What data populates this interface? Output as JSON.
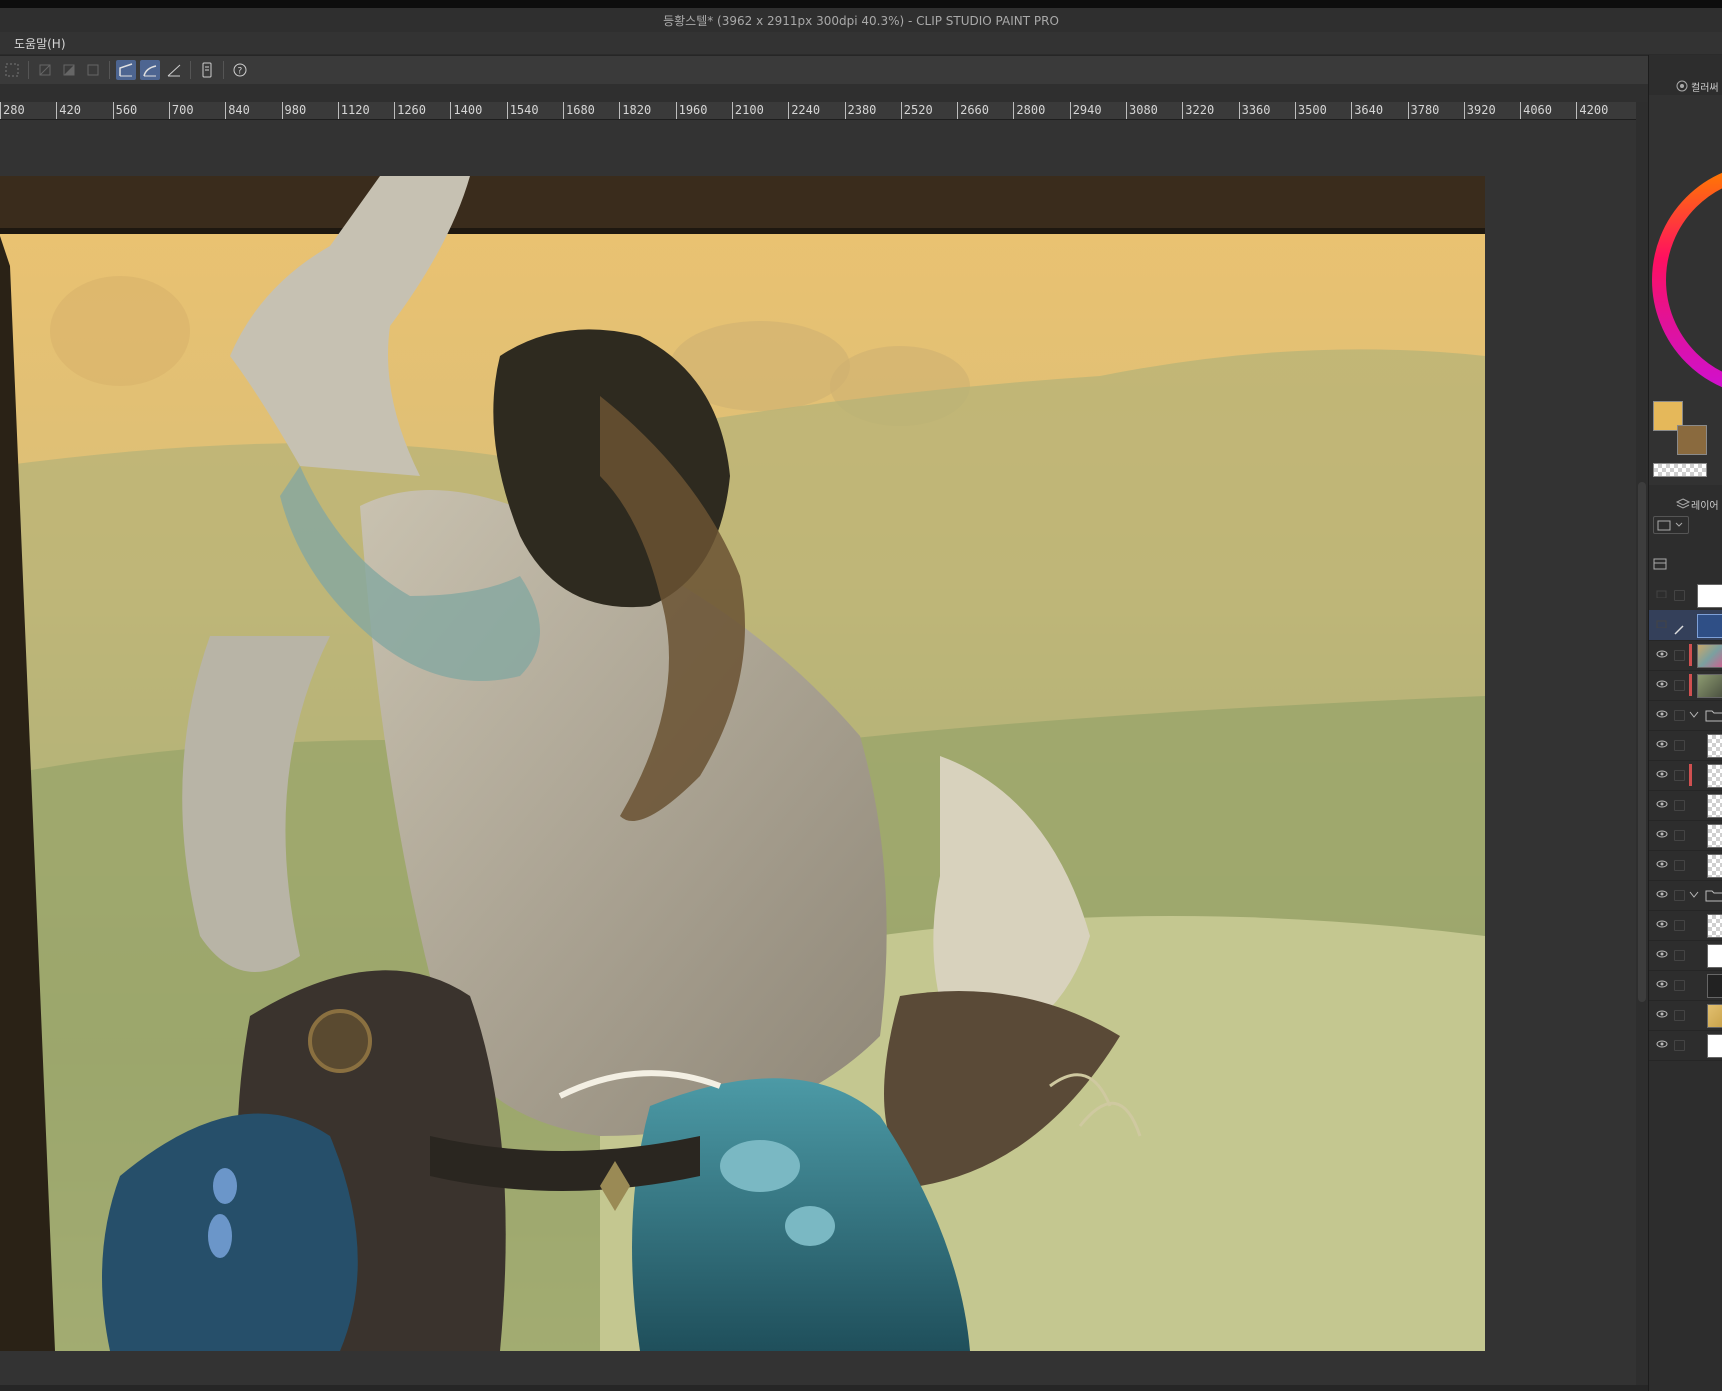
{
  "window": {
    "title": "등황스텔* (3962 x 2911px 300dpi 40.3%)  - CLIP STUDIO PAINT PRO"
  },
  "menu": {
    "items": [
      {
        "label": "도움말(H)"
      }
    ]
  },
  "toolbar": {
    "icons": [
      "select-rect-icon",
      "crop-icon",
      "fill-icon",
      "gradient-icon",
      "frame-icon",
      "pen-icon",
      "brush-curve-icon",
      "ruler-angle-icon",
      "tablet-icon",
      "help-icon"
    ],
    "active": [
      "pen-icon",
      "brush-curve-icon"
    ]
  },
  "ruler": {
    "labels": [
      "280",
      "420",
      "560",
      "700",
      "840",
      "980",
      "1120",
      "1260",
      "1400",
      "1540",
      "1680",
      "1820",
      "1960",
      "2100",
      "2240",
      "2380",
      "2520",
      "2660",
      "2800",
      "2940",
      "3080",
      "3220",
      "3360",
      "3500",
      "3640",
      "3780",
      "3920",
      "4060",
      "4200"
    ]
  },
  "panels": {
    "color": {
      "title": "컬러써",
      "main_color": "#e5b85a",
      "sub_color": "#8a6a3e"
    },
    "layer": {
      "title": "레이어",
      "rows": [
        {
          "visible": false,
          "thumb": "white"
        },
        {
          "visible": false,
          "thumb": "blue",
          "editing": true
        },
        {
          "visible": true,
          "thumb": "art",
          "color_tag": "#d05050"
        },
        {
          "visible": true,
          "thumb": "art2",
          "color_tag": "#d05050"
        },
        {
          "visible": true,
          "thumb": "folder",
          "is_folder": true
        },
        {
          "visible": true,
          "thumb": "checker"
        },
        {
          "visible": true,
          "thumb": "checker",
          "color_tag": "#d05050"
        },
        {
          "visible": true,
          "thumb": "checker"
        },
        {
          "visible": true,
          "thumb": "checker"
        },
        {
          "visible": true,
          "thumb": "checker"
        },
        {
          "visible": true,
          "thumb": "folder",
          "is_folder": true
        },
        {
          "visible": true,
          "thumb": "checker"
        },
        {
          "visible": true,
          "thumb": "sketch"
        },
        {
          "visible": true,
          "thumb": "dark"
        },
        {
          "visible": true,
          "thumb": "gold"
        },
        {
          "visible": true,
          "thumb": "white"
        }
      ]
    }
  },
  "canvas": {
    "description_colors": {
      "sky_top": "#e9bd68",
      "sky_mid": "#b8b576",
      "grass": "#9fa86b",
      "frame": "#2a2216"
    }
  }
}
